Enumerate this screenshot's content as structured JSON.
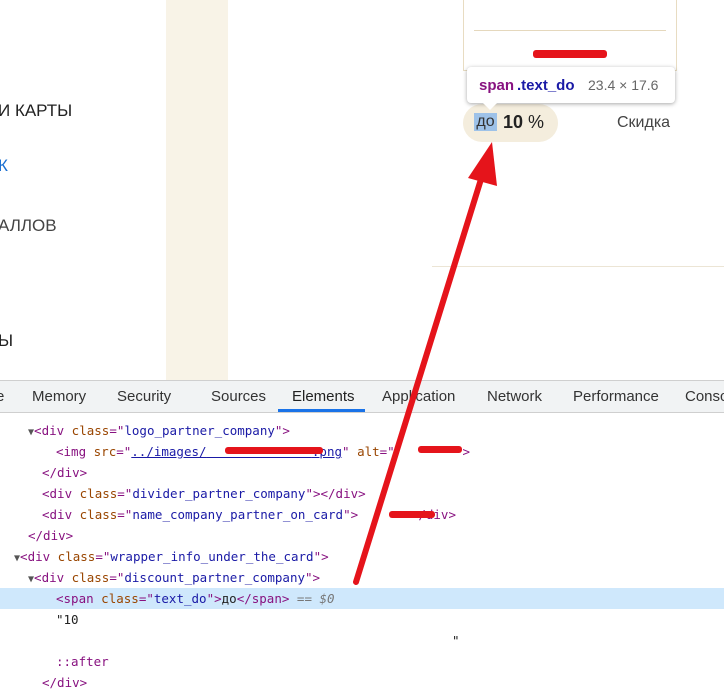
{
  "page": {
    "nav": [
      "И КАРТЫ",
      "К",
      "АЛЛОВ",
      "Ы"
    ],
    "discount": {
      "prefix": "до",
      "value": "10",
      "unit": "%",
      "label": "Скидка"
    },
    "tooltip": {
      "tag": "span",
      "cls": ".text_do",
      "dims": "23.4 × 17.6"
    }
  },
  "devtools": {
    "tabs": [
      "e",
      "Memory",
      "Security",
      "Sources",
      "Elements",
      "Application",
      "Network",
      "Performance",
      "Consc"
    ],
    "active_tab": "Elements",
    "code": {
      "l1": {
        "tag": "div",
        "attr": "class",
        "val": "logo_partner_company"
      },
      "l2": {
        "tag": "img",
        "attr1": "src",
        "src": "../images/",
        "src_end": ".png",
        "attr2": "alt"
      },
      "l3": "</div>",
      "l4": {
        "tag": "div",
        "attr": "class",
        "val": "divider_partner_company",
        "close": "></div>"
      },
      "l5": {
        "tag": "div",
        "attr": "class",
        "val": "name_company_partner_on_card",
        "close": "</div>"
      },
      "l6": "</div>",
      "l7": {
        "tag": "div",
        "attr": "class",
        "val": "wrapper_info_under_the_card"
      },
      "l8": {
        "tag": "div",
        "attr": "class",
        "val": "discount_partner_company"
      },
      "l9": {
        "tag": "span",
        "attr": "class",
        "val": "text_do",
        "text": "до",
        "close": "span",
        "eq": "== $0"
      },
      "l10": "\"10",
      "l11": "\"",
      "l12": "::after",
      "l13": "</div>"
    }
  },
  "colors": {
    "annotation_arrow": "#e5141b",
    "selection": "#cfe8fc",
    "active_tab": "#1a73e8"
  }
}
